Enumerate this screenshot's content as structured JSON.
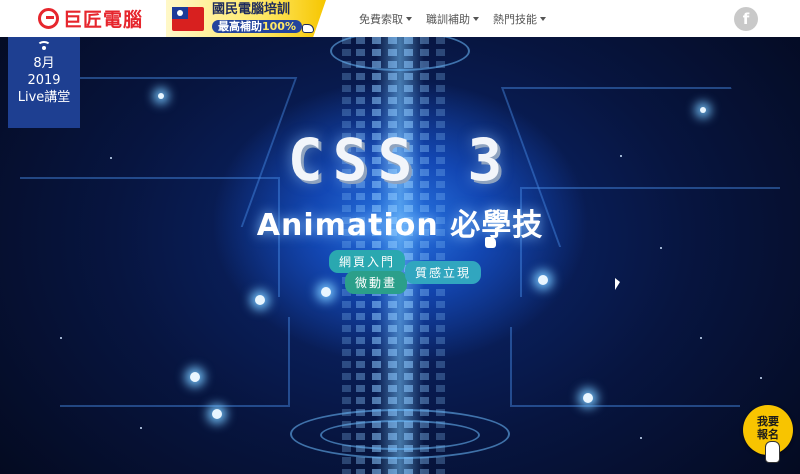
{
  "nav": {
    "logo_text": "巨匠電腦",
    "promo_title": "國民電腦培訓",
    "promo_sub_prefix": "最高補助",
    "promo_sub_value": "100%",
    "menu": [
      {
        "label": "免費索取"
      },
      {
        "label": "職訓補助"
      },
      {
        "label": "熱門技能"
      }
    ],
    "facebook": "f"
  },
  "badge": {
    "line1": "8月",
    "line2": "2019",
    "line3": "Live講堂"
  },
  "hero": {
    "title": "CSS 3",
    "subtitle": "Animation 必學技",
    "tags": [
      "網頁入門",
      "微動畫",
      "質感立現"
    ]
  },
  "signup": {
    "line1": "我要",
    "line2": "報名"
  },
  "colors": {
    "brand_red": "#e6262d",
    "badge_blue": "#1e3f91",
    "signup_yellow": "#f8c400"
  }
}
